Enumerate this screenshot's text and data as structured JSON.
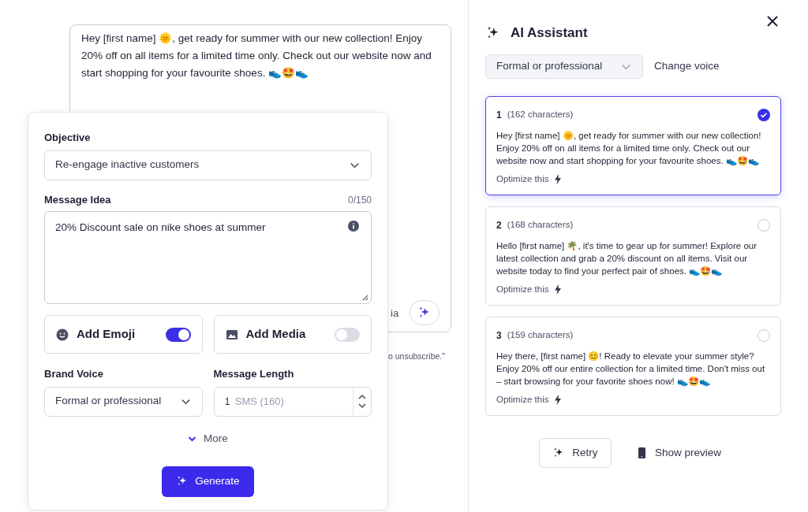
{
  "editor": {
    "message": "Hey [first name] 🌞, get ready for summer with our new collection! Enjoy 20% off on all items for a limited time only. Check out our website now and start shopping for your favourite shoes. 👟🤩👟",
    "hidden_fragment": "ia",
    "footer_fragment": "o unsubscribe.\""
  },
  "form": {
    "objective": {
      "label": "Objective",
      "value": "Re-engage inactive customers"
    },
    "message_idea": {
      "label": "Message Idea",
      "counter": "0/150",
      "value": "20% Discount sale on nike shoes at summer"
    },
    "toggles": [
      {
        "kind": "emoji",
        "label": "Add Emoji",
        "on": true
      },
      {
        "kind": "media",
        "label": "Add Media",
        "on": false
      }
    ],
    "brand_voice": {
      "label": "Brand Voice",
      "value": "Formal or professional"
    },
    "message_length": {
      "label": "Message Length",
      "value": "1",
      "unit": "SMS (160)"
    },
    "more": "More",
    "generate": "Generate"
  },
  "assistant": {
    "title": "AI Assistant",
    "voice": "Formal or professional",
    "change_voice": "Change voice",
    "options": [
      {
        "number": "1",
        "count": "(162 characters)",
        "text": "Hey [first name] 🌞, get ready for summer with our new collection! Enjoy 20% off on all items for a limited time only. Check out our website now and start shopping for your favourite shoes. 👟🤩👟",
        "optimize": "Optimize this",
        "selected": true
      },
      {
        "number": "2",
        "count": "(168 characters)",
        "text": "Hello [first name] 🌴, it's time to gear up for summer! Explore our latest collection and grab a 20% discount on all items. Visit our website today to find your perfect pair of shoes. 👟🤩👟",
        "optimize": "Optimize this",
        "selected": false
      },
      {
        "number": "3",
        "count": "(159 characters)",
        "text": "Hey there, [first name] 😊! Ready to elevate your summer style? Enjoy 20% off our entire collection for a limited time. Don't miss out – start browsing for your favorite shoes now! 👟🤩👟",
        "optimize": "Optimize this",
        "selected": false
      }
    ],
    "retry": "Retry",
    "show_preview": "Show preview"
  }
}
